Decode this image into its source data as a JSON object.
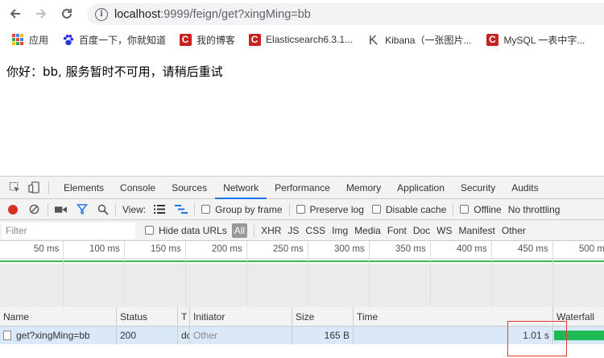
{
  "browser": {
    "url_host": "localhost",
    "url_rest": ":9999/feign/get?xingMing=bb"
  },
  "bookmarks": [
    {
      "label": "应用",
      "icon": "apps-icon"
    },
    {
      "label": "百度一下，你就知道",
      "icon": "baidu-paw-icon"
    },
    {
      "label": "我的博客",
      "icon": "csdn-icon"
    },
    {
      "label": "Elasticsearch6.3.1...",
      "icon": "csdn-icon"
    },
    {
      "label": "Kibana（一张图片...",
      "icon": "kibana-icon"
    },
    {
      "label": "MySQL 一表中字...",
      "icon": "csdn-icon"
    }
  ],
  "page": {
    "message": "你好：bb, 服务暂时不可用，请稍后重试"
  },
  "devtools": {
    "tabs": [
      "Elements",
      "Console",
      "Sources",
      "Network",
      "Performance",
      "Memory",
      "Application",
      "Security",
      "Audits"
    ],
    "active_tab": "Network",
    "toolbar": {
      "view_label": "View:",
      "group_by_frame": "Group by frame",
      "preserve_log": "Preserve log",
      "disable_cache": "Disable cache",
      "offline": "Offline",
      "throttling": "No throttling"
    },
    "filter": {
      "placeholder": "Filter",
      "hide_data_urls": "Hide data URLs",
      "types": [
        "All",
        "XHR",
        "JS",
        "CSS",
        "Img",
        "Media",
        "Font",
        "Doc",
        "WS",
        "Manifest",
        "Other"
      ]
    },
    "overview_ticks": [
      "50 ms",
      "100 ms",
      "150 ms",
      "200 ms",
      "250 ms",
      "300 ms",
      "350 ms",
      "400 ms",
      "450 ms",
      "500 m"
    ],
    "columns": [
      "Name",
      "Status",
      "T",
      "Initiator",
      "Size",
      "Time",
      "Waterfall"
    ],
    "rows": [
      {
        "name": "get?xingMing=bb",
        "status": "200",
        "type": "dc",
        "initiator": "Other",
        "size": "165 B",
        "time": "1.01 s"
      }
    ],
    "colors": {
      "accent": "#1a73e8",
      "record": "#d93025",
      "waterfall": "#1db954",
      "highlight_box": "#e53935"
    }
  }
}
